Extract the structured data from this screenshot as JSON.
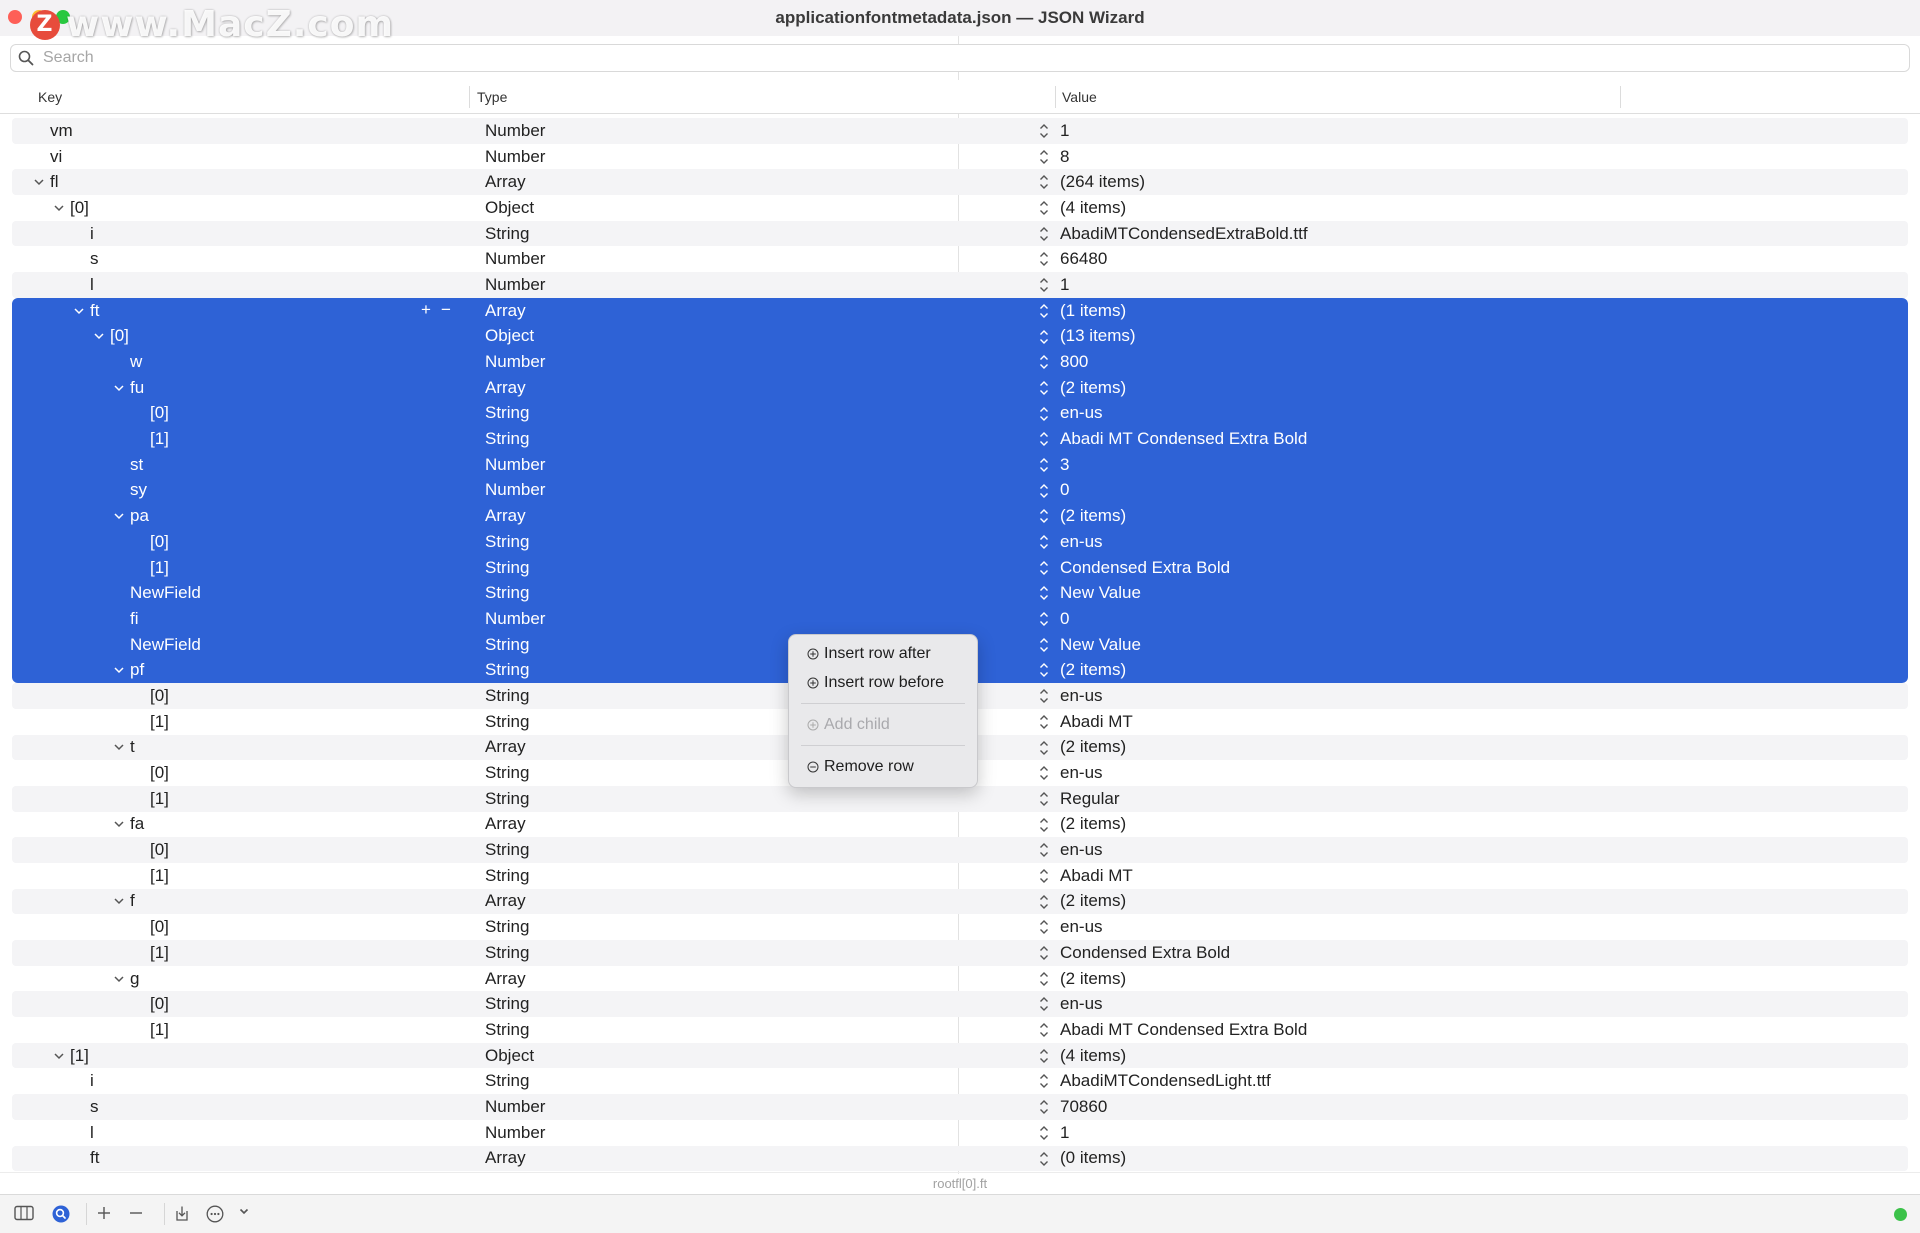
{
  "window": {
    "title": "applicationfontmetadata.json — JSON Wizard"
  },
  "watermark": {
    "logo": "Z",
    "text": "www.MacZ.com"
  },
  "search": {
    "placeholder": "Search",
    "value": ""
  },
  "columns": {
    "key": "Key",
    "type": "Type",
    "value": "Value"
  },
  "rows": [
    {
      "key": "vm",
      "type": "Number",
      "value": "1",
      "level": 0,
      "expander": false
    },
    {
      "key": "vi",
      "type": "Number",
      "value": "8",
      "level": 0,
      "expander": false
    },
    {
      "key": "fl",
      "type": "Array",
      "value": "(264 items)",
      "level": 0,
      "expander": true
    },
    {
      "key": "[0]",
      "type": "Object",
      "value": "(4 items)",
      "level": 1,
      "expander": true
    },
    {
      "key": "i",
      "type": "String",
      "value": "AbadiMTCondensedExtraBold.ttf",
      "level": 2,
      "expander": false
    },
    {
      "key": "s",
      "type": "Number",
      "value": "66480",
      "level": 2,
      "expander": false
    },
    {
      "key": "l",
      "type": "Number",
      "value": "1",
      "level": 2,
      "expander": false
    },
    {
      "key": "ft",
      "type": "Array",
      "value": "(1 items)",
      "level": 2,
      "expander": true,
      "selected": true,
      "controls": true
    },
    {
      "key": "[0]",
      "type": "Object",
      "value": "(13 items)",
      "level": 3,
      "expander": true,
      "selected": true
    },
    {
      "key": "w",
      "type": "Number",
      "value": "800",
      "level": 4,
      "expander": false,
      "selected": true
    },
    {
      "key": "fu",
      "type": "Array",
      "value": "(2 items)",
      "level": 4,
      "expander": true,
      "selected": true
    },
    {
      "key": "[0]",
      "type": "String",
      "value": "en-us",
      "level": 5,
      "expander": false,
      "selected": true
    },
    {
      "key": "[1]",
      "type": "String",
      "value": "Abadi MT Condensed Extra Bold",
      "level": 5,
      "expander": false,
      "selected": true
    },
    {
      "key": "st",
      "type": "Number",
      "value": "3",
      "level": 4,
      "expander": false,
      "selected": true
    },
    {
      "key": "sy",
      "type": "Number",
      "value": "0",
      "level": 4,
      "expander": false,
      "selected": true
    },
    {
      "key": "pa",
      "type": "Array",
      "value": "(2 items)",
      "level": 4,
      "expander": true,
      "selected": true
    },
    {
      "key": "[0]",
      "type": "String",
      "value": "en-us",
      "level": 5,
      "expander": false,
      "selected": true
    },
    {
      "key": "[1]",
      "type": "String",
      "value": "Condensed Extra Bold",
      "level": 5,
      "expander": false,
      "selected": true
    },
    {
      "key": "NewField",
      "type": "String",
      "value": "New Value",
      "level": 4,
      "expander": false,
      "selected": true
    },
    {
      "key": "fi",
      "type": "Number",
      "value": "0",
      "level": 4,
      "expander": false,
      "selected": true
    },
    {
      "key": "NewField",
      "type": "String",
      "value": "New Value",
      "level": 4,
      "expander": false,
      "selected": true
    },
    {
      "key": "pf",
      "type": "String",
      "value": "(2 items)",
      "level": 4,
      "expander": true,
      "selected": true
    },
    {
      "key": "[0]",
      "type": "String",
      "value": "en-us",
      "level": 5,
      "expander": false
    },
    {
      "key": "[1]",
      "type": "String",
      "value": "Abadi MT",
      "level": 5,
      "expander": false
    },
    {
      "key": "t",
      "type": "Array",
      "value": "(2 items)",
      "level": 4,
      "expander": true
    },
    {
      "key": "[0]",
      "type": "String",
      "value": "en-us",
      "level": 5,
      "expander": false
    },
    {
      "key": "[1]",
      "type": "String",
      "value": "Regular",
      "level": 5,
      "expander": false
    },
    {
      "key": "fa",
      "type": "Array",
      "value": "(2 items)",
      "level": 4,
      "expander": true
    },
    {
      "key": "[0]",
      "type": "String",
      "value": "en-us",
      "level": 5,
      "expander": false
    },
    {
      "key": "[1]",
      "type": "String",
      "value": "Abadi MT",
      "level": 5,
      "expander": false
    },
    {
      "key": "f",
      "type": "Array",
      "value": "(2 items)",
      "level": 4,
      "expander": true
    },
    {
      "key": "[0]",
      "type": "String",
      "value": "en-us",
      "level": 5,
      "expander": false
    },
    {
      "key": "[1]",
      "type": "String",
      "value": "Condensed Extra Bold",
      "level": 5,
      "expander": false
    },
    {
      "key": "g",
      "type": "Array",
      "value": "(2 items)",
      "level": 4,
      "expander": true
    },
    {
      "key": "[0]",
      "type": "String",
      "value": "en-us",
      "level": 5,
      "expander": false
    },
    {
      "key": "[1]",
      "type": "String",
      "value": "Abadi MT Condensed Extra Bold",
      "level": 5,
      "expander": false
    },
    {
      "key": "[1]",
      "type": "Object",
      "value": "(4 items)",
      "level": 1,
      "expander": true
    },
    {
      "key": "i",
      "type": "String",
      "value": "AbadiMTCondensedLight.ttf",
      "level": 2,
      "expander": false
    },
    {
      "key": "s",
      "type": "Number",
      "value": "70860",
      "level": 2,
      "expander": false
    },
    {
      "key": "l",
      "type": "Number",
      "value": "1",
      "level": 2,
      "expander": false
    },
    {
      "key": "ft",
      "type": "Array",
      "value": "(0 items)",
      "level": 2,
      "expander": false
    }
  ],
  "row_controls": {
    "add": "+",
    "remove": "−"
  },
  "context_menu": {
    "insert_after": "Insert row after",
    "insert_before": "Insert row before",
    "add_child": "Add child",
    "remove_row": "Remove row"
  },
  "path": "rootfl[0].ft",
  "colors": {
    "selection": "#2e62d6",
    "status": "#3cc24a"
  },
  "icons": [
    "search-icon",
    "chevron-down-icon",
    "stepper-icon",
    "sidebar-toggle-icon",
    "search-badge-icon",
    "plus-icon",
    "minus-icon",
    "import-icon",
    "more-icon",
    "chevron-down-icon"
  ]
}
